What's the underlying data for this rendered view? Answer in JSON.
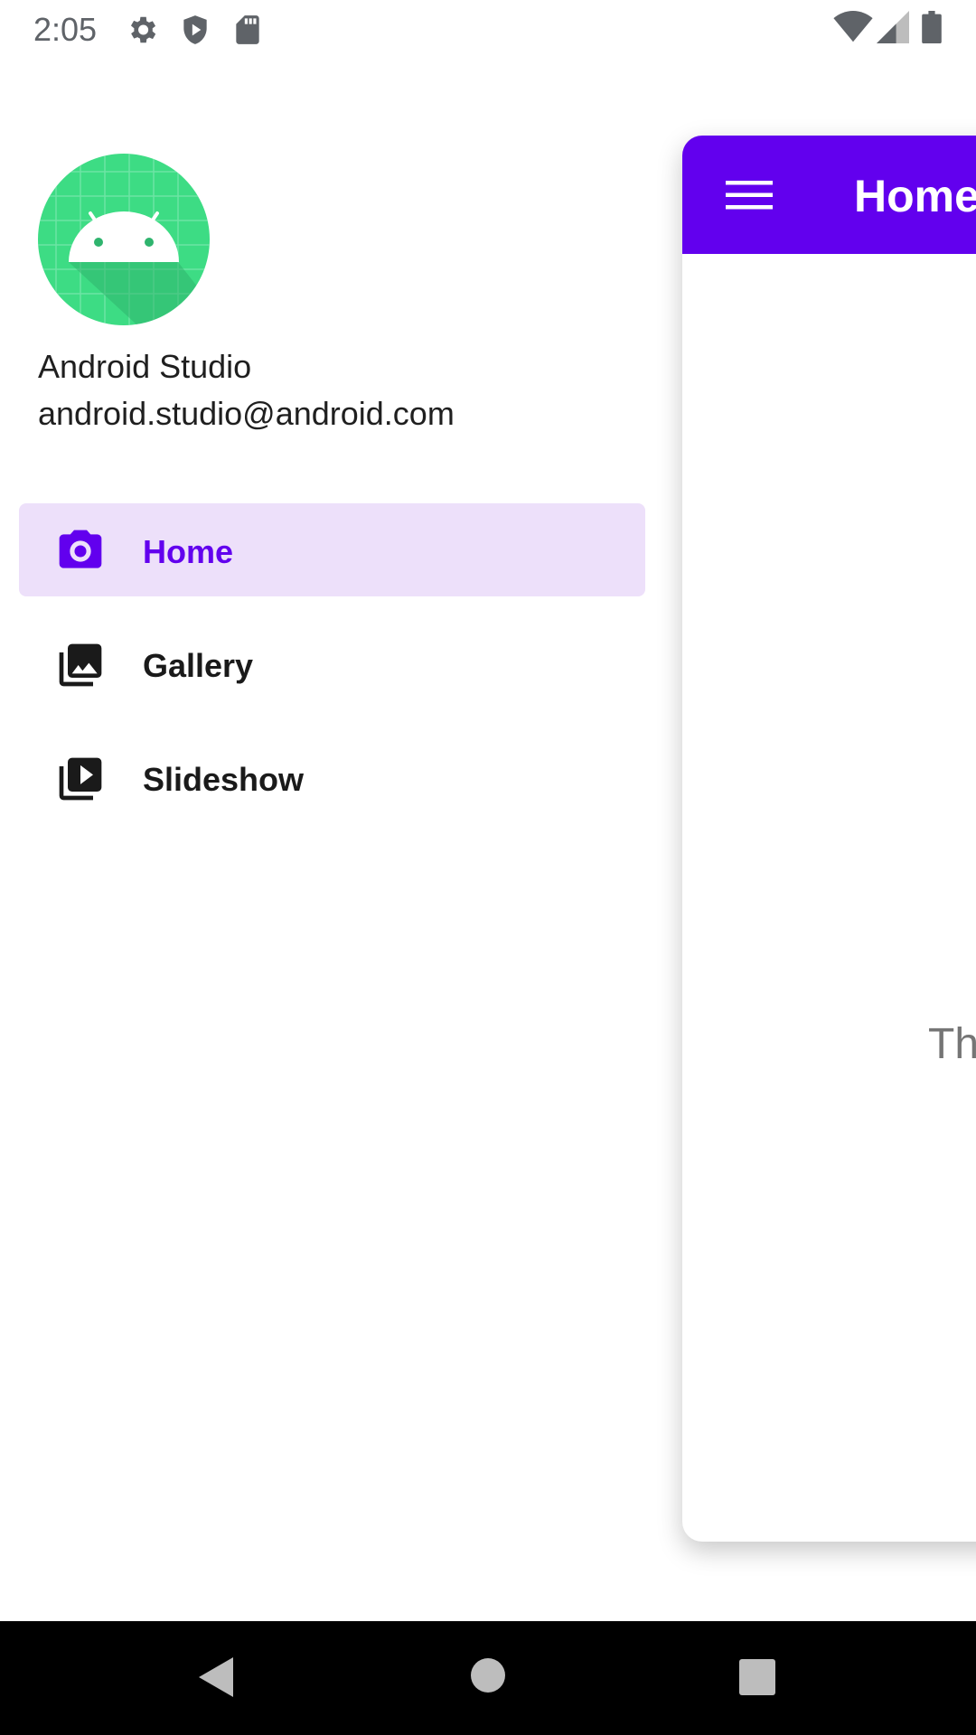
{
  "status_bar": {
    "time": "2:05",
    "icons": [
      "settings-icon",
      "shield-play-icon",
      "sd-card-icon",
      "wifi-icon",
      "signal-icon",
      "battery-icon"
    ]
  },
  "drawer": {
    "avatar_icon": "android-logo",
    "user_name": "Android Studio",
    "user_email": "android.studio@android.com",
    "items": [
      {
        "label": "Home",
        "icon": "camera-icon",
        "selected": true
      },
      {
        "label": "Gallery",
        "icon": "photo-library-icon",
        "selected": false
      },
      {
        "label": "Slideshow",
        "icon": "slideshow-icon",
        "selected": false
      }
    ]
  },
  "main": {
    "app_bar_title": "Home",
    "content_text": "Th"
  },
  "colors": {
    "primary": "#6200ee",
    "selected_bg": "#ede0fa",
    "avatar_green": "#3ddc84"
  },
  "navigation_bar": {
    "buttons": [
      "back-icon",
      "home-icon",
      "recents-icon"
    ]
  }
}
